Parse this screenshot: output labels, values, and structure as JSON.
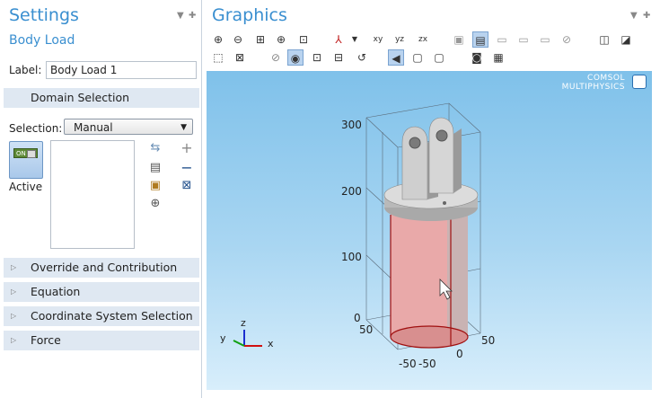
{
  "settings": {
    "title": "Settings",
    "subtitle": "Body Load",
    "label_caption": "Label:",
    "label_value": "Body Load 1",
    "domain_selection": "Domain Selection",
    "selection_caption": "Selection:",
    "selection_value": "Manual",
    "active_label": "Active",
    "toggle_text": "ON",
    "sections": [
      "Override and Contribution",
      "Equation",
      "Coordinate System Selection",
      "Force"
    ]
  },
  "graphics": {
    "title": "Graphics",
    "logo_line1": "COMSOL",
    "logo_line2": "MULTIPHYSICS",
    "axis_labels": {
      "z300": "300",
      "z200": "200",
      "z100": "100",
      "z0": "0",
      "x50": "50",
      "xm50": "-50",
      "y0": "0",
      "y50": "50",
      "ym50": "-50"
    },
    "triad": {
      "z": "z",
      "y": "y",
      "x": "x"
    }
  },
  "icons": {
    "toolbar1": [
      "zoom-in-icon",
      "zoom-out-icon",
      "zoom-box-icon",
      "zoom-selected-icon",
      "zoom-extents-icon",
      "view-axis-icon",
      "xy-view-icon",
      "yz-view-icon",
      "zx-view-icon",
      "transparency-icon",
      "wireframe-icon",
      "render-icon",
      "hide-icon",
      "show-icon",
      "clear-icon",
      "screenshot-icon",
      "snapshot-icon"
    ],
    "toolbar2": [
      "select-box-icon",
      "deselect-icon",
      "hide-items-icon",
      "show-items-icon",
      "view-hidden-icon",
      "reset-hiding-icon",
      "refresh-icon",
      "select-domains-icon",
      "select-boundaries-icon",
      "select-edges-icon",
      "camera-icon",
      "print-icon"
    ]
  },
  "colors": {
    "accent": "#3a8fd0",
    "section_bg": "#dfe8f2",
    "cylinder": "#e8a7a7",
    "edge": "#b01010"
  }
}
